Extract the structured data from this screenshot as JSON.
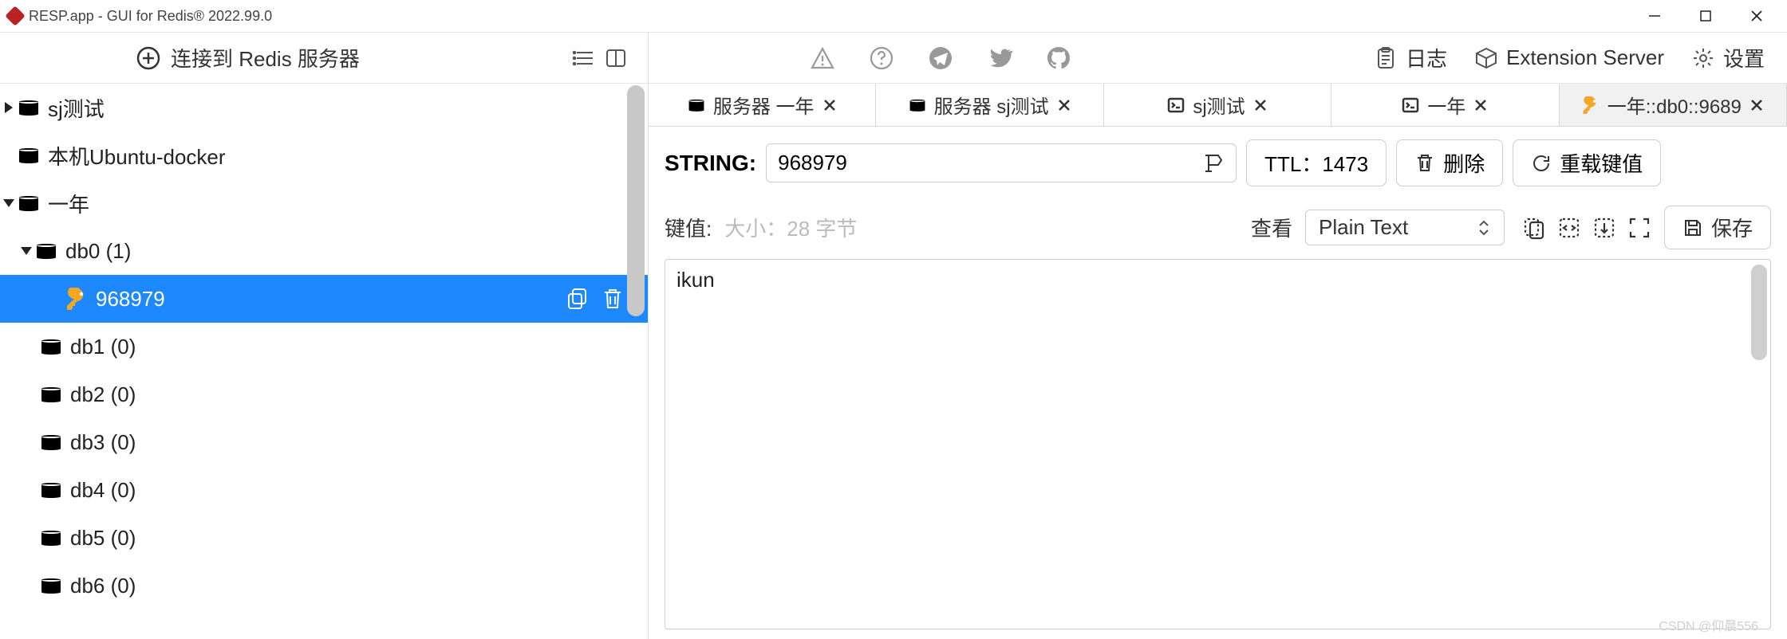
{
  "window": {
    "title": "RESP.app - GUI for Redis® 2022.99.0"
  },
  "left_toolbar": {
    "connect_label": "连接到 Redis 服务器"
  },
  "tree": {
    "conn_sj": "sj测试",
    "conn_ubuntu": "本机Ubuntu-docker",
    "conn_year": "一年",
    "db0": "db0  (1)",
    "key": "968979",
    "db1": "db1  (0)",
    "db2": "db2  (0)",
    "db3": "db3  (0)",
    "db4": "db4  (0)",
    "db5": "db5  (0)",
    "db6": "db6  (0)"
  },
  "right_toolbar": {
    "logs": "日志",
    "ext": "Extension Server",
    "settings": "设置"
  },
  "tabs": {
    "t1": "服务器 一年",
    "t2": "服务器 sj测试",
    "t3": "sj测试",
    "t4": "一年",
    "t5": "一年::db0::9689"
  },
  "key_head": {
    "type_label": "STRING:",
    "key_name": "968979",
    "ttl_label": "TTL：1473",
    "delete_label": "删除",
    "reload_label": "重载键值"
  },
  "val_meta": {
    "label": "键值: ",
    "hint": "大小：28 字节",
    "view_label": "查看",
    "format": "Plain Text",
    "save": "保存"
  },
  "value": "ikun",
  "watermark": "CSDN @仰晨556"
}
